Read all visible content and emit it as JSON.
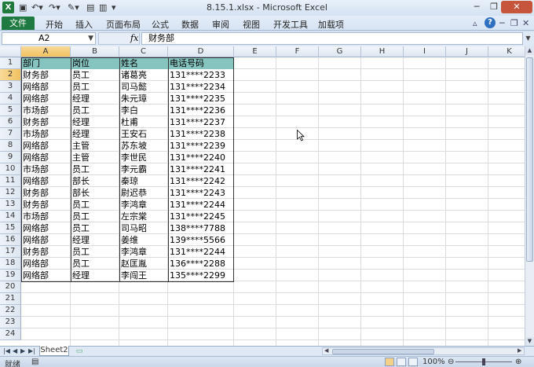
{
  "window": {
    "title": "8.15.1.xlsx  -  Microsoft Excel",
    "app_icon_letter": "X"
  },
  "ribbon": {
    "file_tab": "文件",
    "tabs": [
      "开始",
      "插入",
      "页面布局",
      "公式",
      "数据",
      "审阅",
      "视图",
      "开发工具",
      "加载项"
    ]
  },
  "formula_bar": {
    "name_box": "A2",
    "fx_label": "fx",
    "content": "财务部"
  },
  "grid": {
    "columns": [
      "A",
      "B",
      "C",
      "D",
      "E",
      "F",
      "G",
      "H",
      "I",
      "J",
      "K"
    ],
    "rows": [
      "1",
      "2",
      "3",
      "4",
      "5",
      "6",
      "7",
      "8",
      "9",
      "10",
      "11",
      "12",
      "13",
      "14",
      "15",
      "16",
      "17",
      "18",
      "19",
      "20",
      "21",
      "22",
      "23",
      "24"
    ],
    "header_fill": "#86c4c0",
    "table_header": [
      "部门",
      "岗位",
      "姓名",
      "电话号码"
    ],
    "table_rows": [
      [
        "财务部",
        "员工",
        "诸葛亮",
        "131****2233"
      ],
      [
        "网络部",
        "员工",
        "司马懿",
        "131****2234"
      ],
      [
        "网络部",
        "经理",
        "朱元璋",
        "131****2235"
      ],
      [
        "市场部",
        "员工",
        "李白",
        "131****2236"
      ],
      [
        "财务部",
        "经理",
        "杜甫",
        "131****2237"
      ],
      [
        "市场部",
        "经理",
        "王安石",
        "131****2238"
      ],
      [
        "网络部",
        "主管",
        "苏东坡",
        "131****2239"
      ],
      [
        "网络部",
        "主管",
        "李世民",
        "131****2240"
      ],
      [
        "市场部",
        "员工",
        "李元霸",
        "131****2241"
      ],
      [
        "网络部",
        "部长",
        "秦琼",
        "131****2242"
      ],
      [
        "财务部",
        "部长",
        "尉迟恭",
        "131****2243"
      ],
      [
        "财务部",
        "员工",
        "李鸿章",
        "131****2244"
      ],
      [
        "市场部",
        "员工",
        "左宗棠",
        "131****2245"
      ],
      [
        "网络部",
        "员工",
        "司马昭",
        "138****7788"
      ],
      [
        "网络部",
        "经理",
        "姜维",
        "139****5566"
      ],
      [
        "财务部",
        "员工",
        "李鸿章",
        "131****2244"
      ],
      [
        "网络部",
        "员工",
        "赵匡胤",
        "136****2288"
      ],
      [
        "网络部",
        "经理",
        "李闯王",
        "135****2299"
      ]
    ]
  },
  "sheet_tabs": {
    "active": "Sheet2"
  },
  "status_bar": {
    "ready": "就绪",
    "zoom": "100%"
  }
}
